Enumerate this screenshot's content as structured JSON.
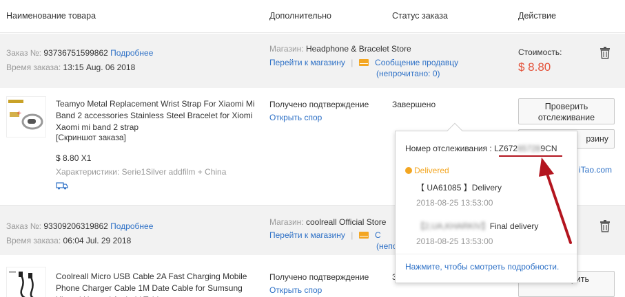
{
  "header": {
    "col_product": "Наименование товара",
    "col_extra": "Дополнительно",
    "col_status": "Статус заказа",
    "col_action": "Действие"
  },
  "order1": {
    "order_label": "Заказ №:",
    "order_number": "93736751599862",
    "details_link": "Подробнее",
    "time_label": "Время заказа:",
    "time_value": "13:15 Aug. 06 2018",
    "store_label": "Магазин:",
    "store_name": "Headphone & Bracelet Store",
    "go_store": "Перейти к магазину",
    "separator": "|",
    "msg_seller": "Сообщение продавцу",
    "unread_prefix": "(непрочитано:",
    "unread_count": "0",
    "unread_suffix": ")",
    "cost_label": "Стоимость:",
    "cost_value": "$ 8.80",
    "product_title": "Teamyo Metal Replacement Wrist Strap For Xiaomi Mi Band 2 accessories Stainless Steel Bracelet for Xiomi Xaomi mi band 2 strap",
    "snapshot": "[Скриншот заказа]",
    "price_qty": "$ 8.80 X1",
    "specs_label": "Характеристики:",
    "specs_value": "Serie1Silver addfilm + China",
    "received": "Получено подтверждение",
    "dispute": "Открыть спор",
    "status": "Завершено",
    "track_btn_line1": "Проверить",
    "track_btn_line2": "отслеживание",
    "cart_btn_partial": "рзину",
    "partial_link": "iTao.com"
  },
  "order2": {
    "order_label": "Заказ №:",
    "order_number": "93309206319862",
    "details_link": "Подробнее",
    "time_label": "Время заказа:",
    "time_value": "06:04 Jul. 29 2018",
    "store_label": "Магазин:",
    "store_name": "coolreall Official Store",
    "go_store": "Перейти к магазину",
    "separator": "|",
    "msg_partial": "С",
    "unread_partial": "(непо",
    "product_title": "Coolreall Micro USB Cable 2A Fast Charging Mobile Phone Charger Cable 1M Date Cable for Sumsung Xiaomi Huawei Android Tablet",
    "received": "Получено подтверждение",
    "dispute": "Открыть спор",
    "status_partial": "З",
    "track_btn_partial": "рить"
  },
  "popup": {
    "tracking_label": "Номер отслеживания :",
    "tracking_start": "LZ672",
    "tracking_blur": "65728",
    "tracking_end": "9CN",
    "status": "Delivered",
    "event1_text": "【 UA61085 】Delivery",
    "event1_time": "2018-08-25 13:53:00",
    "event2_blur": "【2,UA,KHARKIV】",
    "event2_text": "Final delivery",
    "event2_time": "2018-08-25 13:53:00",
    "more_link": "Нажмите, чтобы смотреть подробности."
  },
  "colors": {
    "link": "#2d70c6",
    "price": "#e4523a",
    "delivered": "#f3a622",
    "annotation": "#b3151f"
  }
}
